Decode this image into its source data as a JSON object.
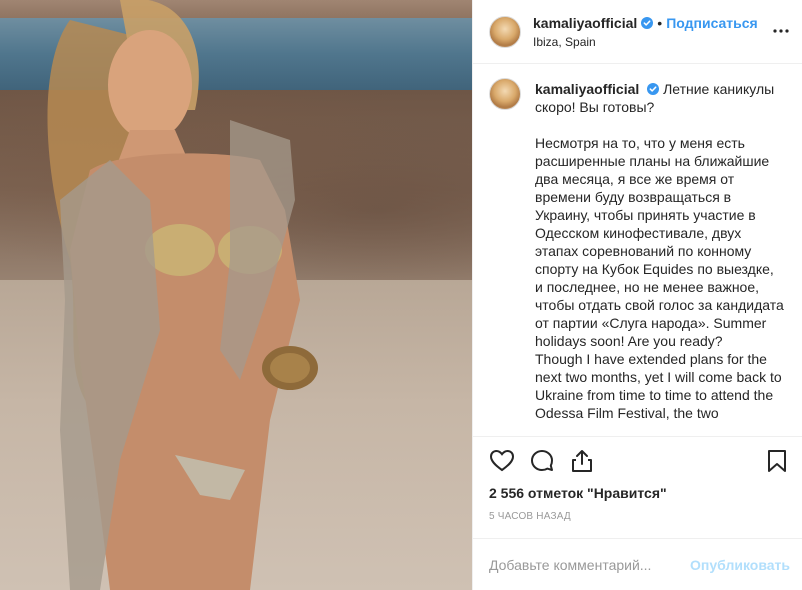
{
  "post": {
    "username": "kamaliyaofficial",
    "follow_label": "Подписаться",
    "dot": "•",
    "location": "Ibiza, Spain"
  },
  "caption": {
    "username": "kamaliyaofficial",
    "lines": [
      "Летние каникулы скоро! Вы готовы?",
      "",
      "Несмотря на то, что у меня есть расширенные планы на ближайшие два месяца, я все же время от времени буду возвращаться в Украину, чтобы принять участие в Одесском кинофестивале, двух этапах соревнований по конному спорту на Кубок Equides по выездке, и последнее, но не менее важное, чтобы отдать свой голос за кандидата от партии «Слуга народа». Summer holidays soon! Are you ready?",
      "Though I have extended plans for the next two months, yet I will come back to Ukraine from time to time to attend the Odessa Film Festival, the two"
    ]
  },
  "likes_text": "2 556 отметок \"Нравится\"",
  "time_text": "5 часов назад",
  "comment": {
    "placeholder": "Добавьте комментарий...",
    "publish_label": "Опубликовать"
  },
  "icons": {
    "verified": "verified-badge-icon",
    "more": "more-options-icon",
    "like": "heart-icon",
    "comment": "comment-bubble-icon",
    "share": "share-icon",
    "save": "bookmark-icon"
  },
  "colors": {
    "accent": "#3897f0",
    "publish_disabled": "#b2dffc",
    "muted": "#999999",
    "text": "#262626"
  }
}
